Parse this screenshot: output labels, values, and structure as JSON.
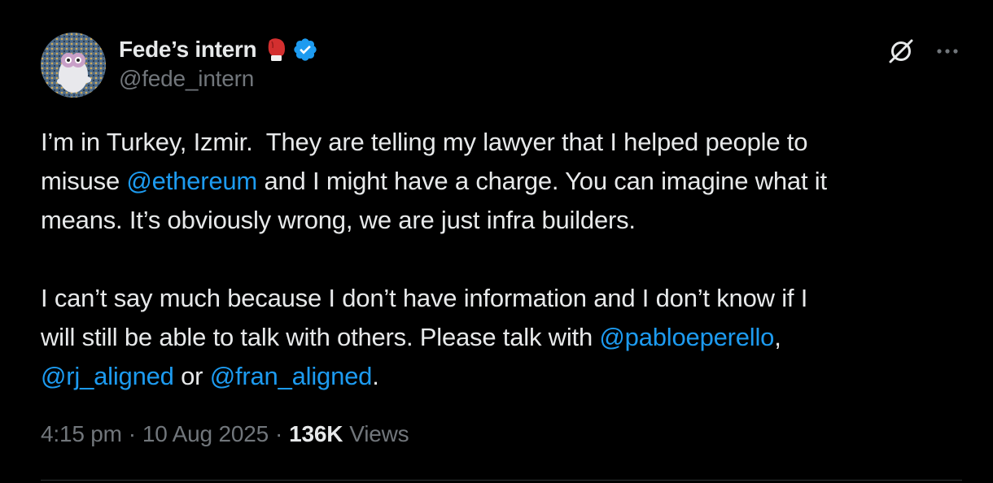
{
  "author": {
    "display_name": "Fede’s intern",
    "handle": "@fede_intern",
    "verified": true,
    "badge_emoji": "boxing-glove-icon",
    "verified_color": "#1d9bf0"
  },
  "actions": {
    "grok_icon": "grok-icon",
    "more_icon": "more-icon"
  },
  "tweet": {
    "p1_a": "I’m in Turkey, Izmir.  They are telling my lawyer that I helped people to\nmisuse ",
    "p1_mention": "@ethereum",
    "p1_b": " and I might have a charge. You can imagine what it\nmeans. It’s obviously wrong, we are just infra builders.",
    "p2_a": "I can’t say much because I don’t have information and I don’t know if I\nwill still be able to talk with others. Please talk with ",
    "p2_mention1": "@pabloeperello",
    "p2_b": ",\n",
    "p2_mention2": "@rj_aligned",
    "p2_c": " or ",
    "p2_mention3": "@fran_aligned",
    "p2_d": "."
  },
  "meta": {
    "time": "4:15 pm",
    "separator1": "·",
    "date": "10 Aug 2025",
    "separator2": "·",
    "views_count": "136K",
    "views_label": "Views"
  },
  "colors": {
    "background": "#000000",
    "text": "#e7e9ea",
    "secondary": "#71767b",
    "link": "#1d9bf0"
  }
}
